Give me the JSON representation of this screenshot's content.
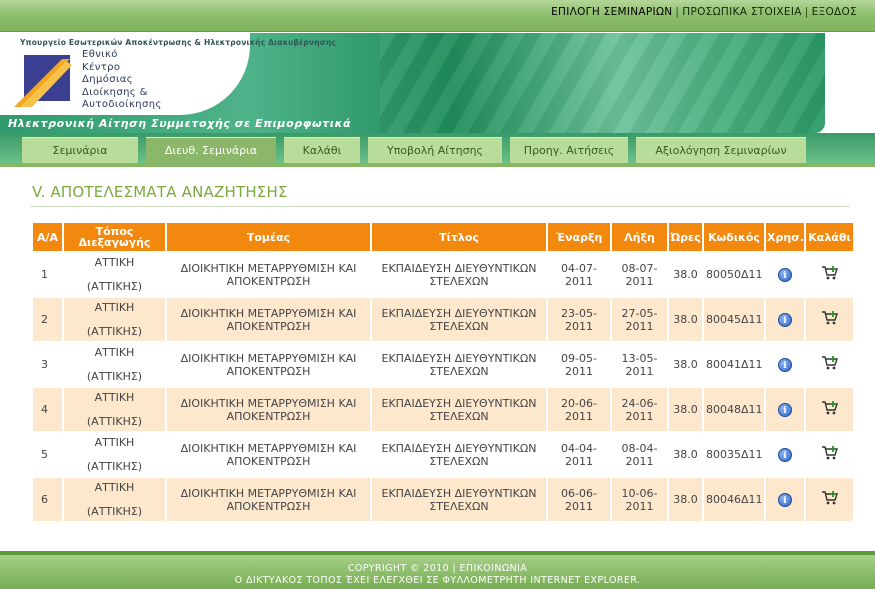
{
  "top_nav": {
    "select_seminars": "ΕΠΙΛΟΓΗ ΣΕΜΙΝΑΡΙΩΝ",
    "personal_info": "ΠΡΟΣΩΠΙΚΑ ΣΤΟΙΧΕΙΑ",
    "logout": "ΕΞΟΔΟΣ",
    "separator": "|"
  },
  "banner": {
    "ministry": "Υπουργείο Εσωτερικών Αποκέντρωσης & Ηλεκτρονικής Διακυβέρνησης",
    "institution_lines": [
      "Εθνικό",
      "Κέντρο",
      "Δημόσιας",
      "Διοίκησης &",
      "Αυτοδιοίκησης"
    ],
    "app_title": "Ηλεκτρονική Αίτηση Συμμετοχής σε Επιμορφωτικά"
  },
  "tabs": [
    {
      "label": "Σεμινάρια",
      "active": false
    },
    {
      "label": "Διευθ. Σεμινάρια",
      "active": true
    },
    {
      "label": "Καλάθι",
      "active": false
    },
    {
      "label": "Υποβολή Αίτησης",
      "active": false
    },
    {
      "label": "Προηγ. Αιτήσεις",
      "active": false
    },
    {
      "label": "Αξιολόγηση Σεμιναρίων",
      "active": false
    }
  ],
  "main": {
    "heading": "V. ΑΠΟΤΕΛΕΣΜΑΤΑ ΑΝΑΖΗΤΗΣΗΣ"
  },
  "table": {
    "headers": [
      "Α/Α",
      "Τόπος Διεξαγωγής",
      "Τομέας",
      "Τίτλος",
      "Έναρξη",
      "Λήξη",
      "Ώρες",
      "Κωδικός",
      "Χρησ.",
      "Καλάθι"
    ],
    "rows": [
      {
        "idx": "1",
        "place_line1": "ΑΤΤΙΚΗ",
        "place_line2": "(ΑΤΤΙΚΗΣ)",
        "sector": "ΔΙΟΙΚΗΤΙΚΗ ΜΕΤΑΡΡΥΘΜΙΣΗ ΚΑΙ ΑΠΟΚΕΝΤΡΩΣΗ",
        "title": "ΕΚΠΑΙΔΕΥΣΗ ΔΙΕΥΘΥΝΤΙΚΩΝ ΣΤΕΛΕΧΩΝ",
        "start": "04-07-2011",
        "end": "08-07-2011",
        "hours": "38.0",
        "code": "80050Δ11"
      },
      {
        "idx": "2",
        "place_line1": "ΑΤΤΙΚΗ",
        "place_line2": "(ΑΤΤΙΚΗΣ)",
        "sector": "ΔΙΟΙΚΗΤΙΚΗ ΜΕΤΑΡΡΥΘΜΙΣΗ ΚΑΙ ΑΠΟΚΕΝΤΡΩΣΗ",
        "title": "ΕΚΠΑΙΔΕΥΣΗ ΔΙΕΥΘΥΝΤΙΚΩΝ ΣΤΕΛΕΧΩΝ",
        "start": "23-05-2011",
        "end": "27-05-2011",
        "hours": "38.0",
        "code": "80045Δ11"
      },
      {
        "idx": "3",
        "place_line1": "ΑΤΤΙΚΗ",
        "place_line2": "(ΑΤΤΙΚΗΣ)",
        "sector": "ΔΙΟΙΚΗΤΙΚΗ ΜΕΤΑΡΡΥΘΜΙΣΗ ΚΑΙ ΑΠΟΚΕΝΤΡΩΣΗ",
        "title": "ΕΚΠΑΙΔΕΥΣΗ ΔΙΕΥΘΥΝΤΙΚΩΝ ΣΤΕΛΕΧΩΝ",
        "start": "09-05-2011",
        "end": "13-05-2011",
        "hours": "38.0",
        "code": "80041Δ11"
      },
      {
        "idx": "4",
        "place_line1": "ΑΤΤΙΚΗ",
        "place_line2": "(ΑΤΤΙΚΗΣ)",
        "sector": "ΔΙΟΙΚΗΤΙΚΗ ΜΕΤΑΡΡΥΘΜΙΣΗ ΚΑΙ ΑΠΟΚΕΝΤΡΩΣΗ",
        "title": "ΕΚΠΑΙΔΕΥΣΗ ΔΙΕΥΘΥΝΤΙΚΩΝ ΣΤΕΛΕΧΩΝ",
        "start": "20-06-2011",
        "end": "24-06-2011",
        "hours": "38.0",
        "code": "80048Δ11"
      },
      {
        "idx": "5",
        "place_line1": "ΑΤΤΙΚΗ",
        "place_line2": "(ΑΤΤΙΚΗΣ)",
        "sector": "ΔΙΟΙΚΗΤΙΚΗ ΜΕΤΑΡΡΥΘΜΙΣΗ ΚΑΙ ΑΠΟΚΕΝΤΡΩΣΗ",
        "title": "ΕΚΠΑΙΔΕΥΣΗ ΔΙΕΥΘΥΝΤΙΚΩΝ ΣΤΕΛΕΧΩΝ",
        "start": "04-04-2011",
        "end": "08-04-2011",
        "hours": "38.0",
        "code": "80035Δ11"
      },
      {
        "idx": "6",
        "place_line1": "ΑΤΤΙΚΗ",
        "place_line2": "(ΑΤΤΙΚΗΣ)",
        "sector": "ΔΙΟΙΚΗΤΙΚΗ ΜΕΤΑΡΡΥΘΜΙΣΗ ΚΑΙ ΑΠΟΚΕΝΤΡΩΣΗ",
        "title": "ΕΚΠΑΙΔΕΥΣΗ ΔΙΕΥΘΥΝΤΙΚΩΝ ΣΤΕΛΕΧΩΝ",
        "start": "06-06-2011",
        "end": "10-06-2011",
        "hours": "38.0",
        "code": "80046Δ11"
      }
    ],
    "info_icon": "info-icon",
    "cart_icon": "add-to-cart-icon"
  },
  "footer": {
    "copyright": "COPYRIGHT © 2010",
    "separator": "|",
    "contact": "ΕΠΙΚΟΙΝΩΝΙΑ",
    "browser_note": "Ο ΔΙΚΤΥΑΚΟΣ ΤΟΠΟΣ ΈΧΕΙ ΕΛΕΓΧΘΕΙ ΣΕ ΦΥΛΛΟΜΕΤΡΗΤΗ INTERNET EXPLORER."
  },
  "colors": {
    "header_green": "#8fbf6e",
    "tab_green": "#b8dc9a",
    "tab_active": "#8cb76a",
    "table_header_orange": "#f3880f",
    "row_alt": "#fde8cd",
    "heading_green": "#7aaa3e"
  }
}
